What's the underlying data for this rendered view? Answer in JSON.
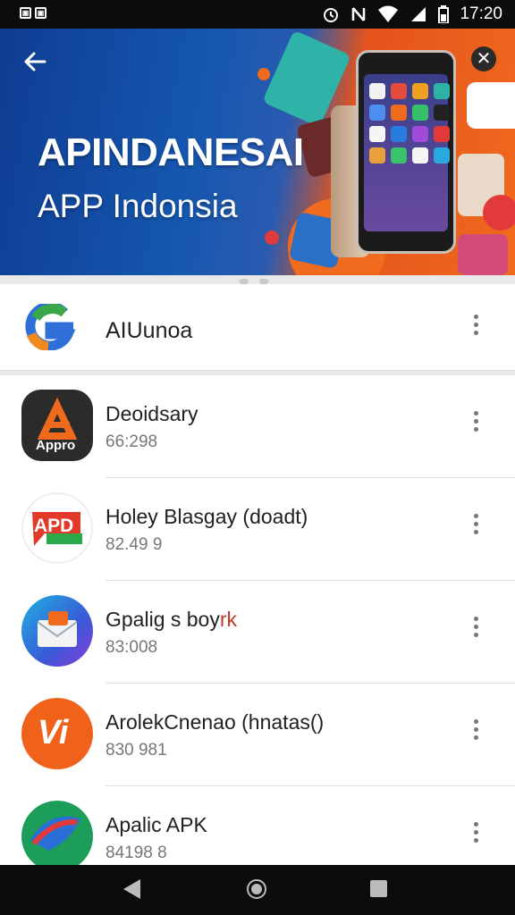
{
  "status_bar": {
    "time": "17:20",
    "left_icons": [
      "notification-box-icon",
      "notification-box-icon"
    ],
    "right_icons": [
      "alarm-icon",
      "nfc-icon",
      "wifi-icon",
      "signal-icon",
      "battery-icon"
    ]
  },
  "banner": {
    "title": "APINDANESAI",
    "subtitle": "APP Indonsia",
    "colors": {
      "left": "#0f3c92",
      "right": "#f06a1e"
    }
  },
  "featured": {
    "name": "AIUunoa",
    "icon": "g-logo-icon"
  },
  "apps": [
    {
      "name": "Deoidsary",
      "size": "66:298",
      "icon": "appro-logo-icon",
      "icon_text": "Appro",
      "color": "#2b2b2b"
    },
    {
      "name": "Holey Blasgay (doadt)",
      "size": "82.49 9",
      "icon": "apd-logo-icon",
      "icon_text": "APD",
      "color": "#ffffff"
    },
    {
      "name": "Gpalig s boy",
      "name_suffix": "rk",
      "size": "83:008",
      "icon": "mail-icon",
      "color": "#2d7be0"
    },
    {
      "name": "ArolekCnenao (hnatas()",
      "size": "830 981",
      "icon": "v-logo-icon",
      "icon_text": "Vi",
      "color": "#f0621a"
    },
    {
      "name": "Apalic APK",
      "size": "84198 8",
      "icon": "fish-logo-icon",
      "color": "#1c9d5a"
    }
  ]
}
